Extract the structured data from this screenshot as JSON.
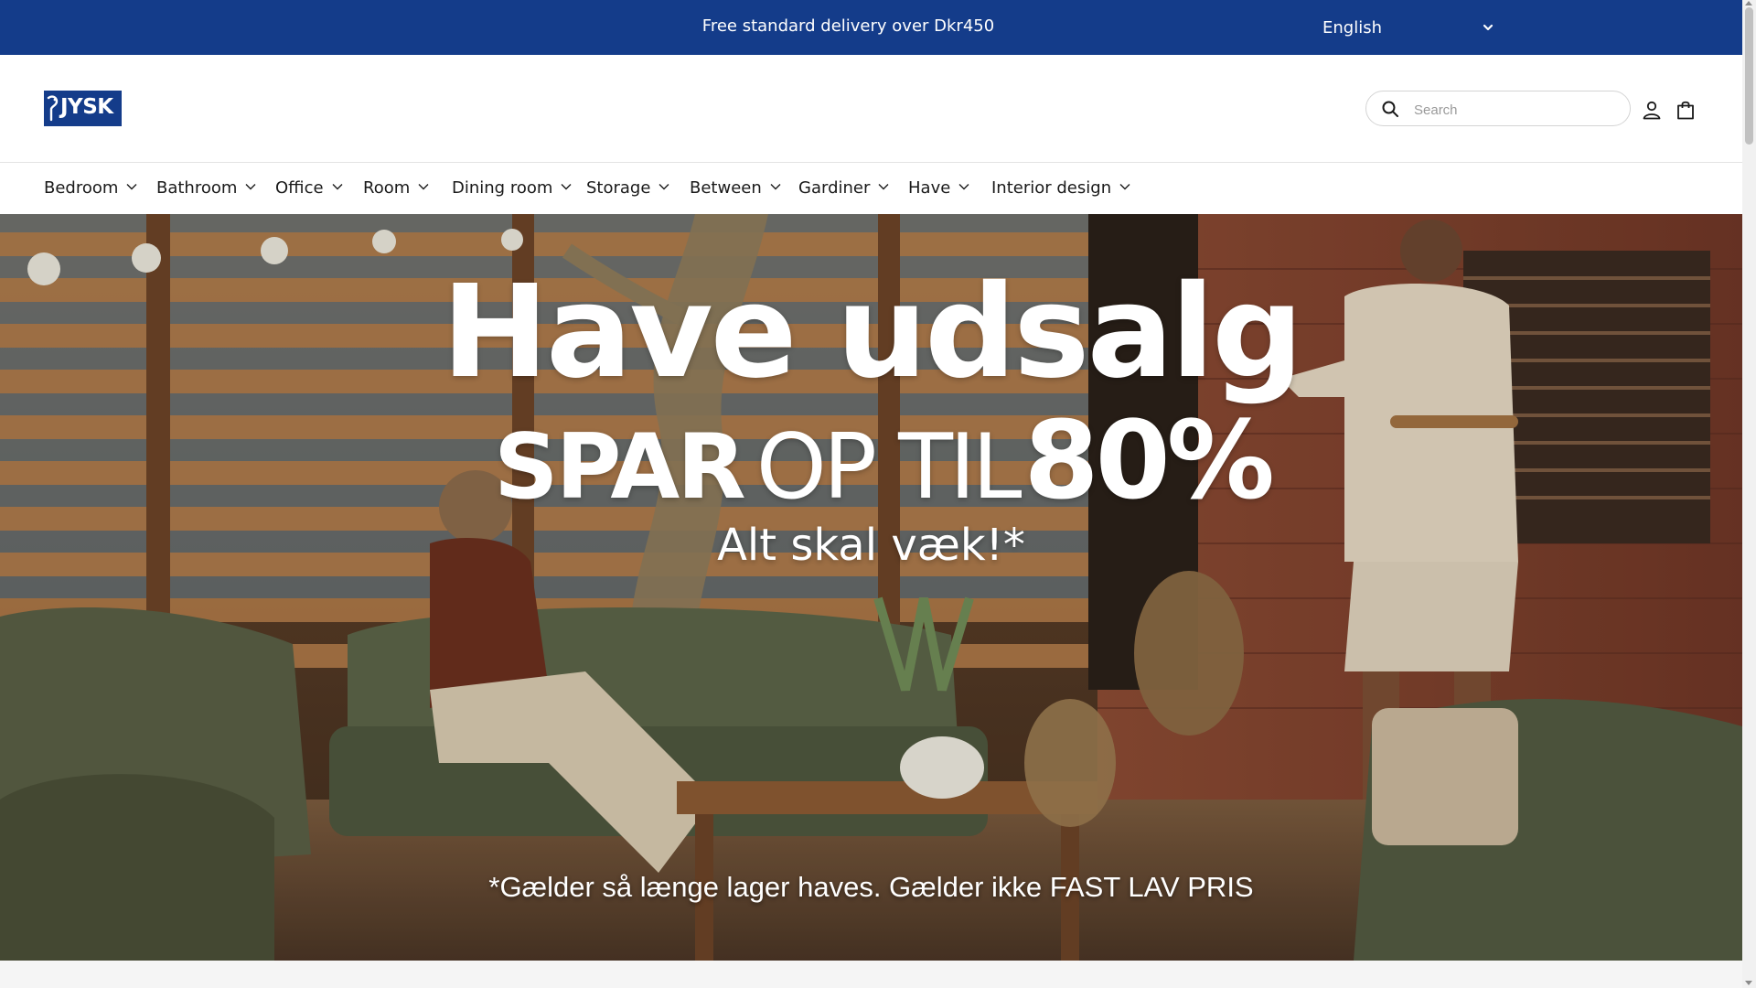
{
  "topbar": {
    "promo": "Free standard delivery over Dkr450",
    "language": "English"
  },
  "header": {
    "logo": "JYSK",
    "search_placeholder": "Search",
    "icons": [
      "search-icon",
      "user-icon",
      "shopping-bag-icon"
    ]
  },
  "nav": {
    "items": [
      {
        "label": "Bedroom"
      },
      {
        "label": "Bathroom"
      },
      {
        "label": "Office"
      },
      {
        "label": "Room"
      },
      {
        "label": "Dining room"
      },
      {
        "label": "Storage"
      },
      {
        "label": "Between"
      },
      {
        "label": "Gardiner"
      },
      {
        "label": "Have"
      },
      {
        "label": "Interior design"
      }
    ]
  },
  "hero": {
    "title": "Have udsalg",
    "line2_bold": "SPAR",
    "line2_light": "OP TIL",
    "line2_percent": "80%",
    "line3": "Alt skal væk!*",
    "footnote": "*Gælder så længe lager haves. Gælder ikke FAST LAV PRIS"
  },
  "colors": {
    "brand_blue": "#143c8a",
    "background": "#ffffff",
    "text": "#1a1a1a"
  }
}
